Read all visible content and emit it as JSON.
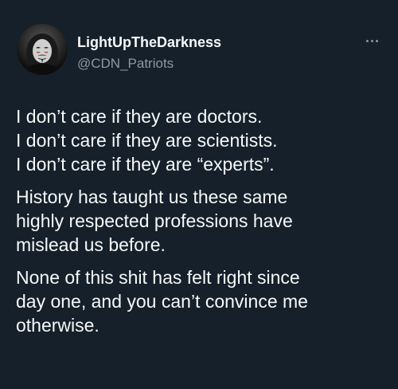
{
  "user": {
    "display_name": "LightUpTheDarkness",
    "handle": "@CDN_Patriots",
    "avatar_icon": "masked-face-avatar-icon"
  },
  "more_icon": "more-options-icon",
  "tweet": {
    "paragraphs": [
      {
        "lines": [
          "I don’t care if they are doctors.",
          "I don’t care if they are scientists.",
          "I don’t care if they are “experts”."
        ]
      },
      {
        "lines": [
          "History has taught us these same",
          "highly respected professions have",
          "mislead us before."
        ]
      },
      {
        "lines": [
          "None of this shit has felt right since",
          "day one, and you can’t convince me",
          "otherwise."
        ]
      }
    ]
  },
  "colors": {
    "background": "#15202b",
    "primary_text": "#f7f9f9",
    "secondary_text": "#8b98a5"
  }
}
